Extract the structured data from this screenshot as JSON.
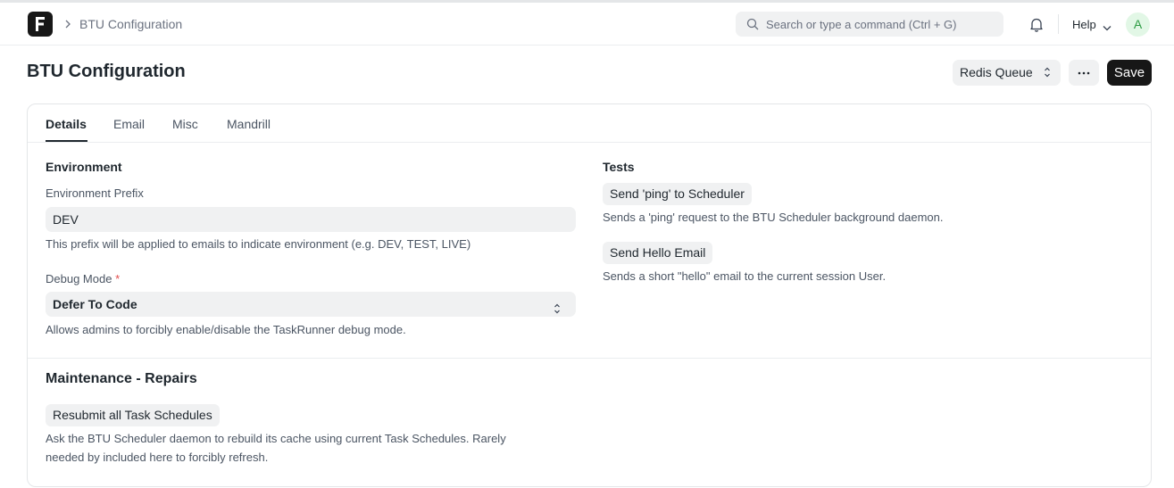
{
  "navbar": {
    "breadcrumb": "BTU Configuration",
    "search_placeholder": "Search or type a command (Ctrl + G)",
    "help_label": "Help",
    "avatar_initial": "A"
  },
  "header": {
    "title": "BTU Configuration",
    "queue_label": "Redis Queue",
    "save_label": "Save"
  },
  "tabs": [
    {
      "label": "Details",
      "active": true
    },
    {
      "label": "Email",
      "active": false
    },
    {
      "label": "Misc",
      "active": false
    },
    {
      "label": "Mandrill",
      "active": false
    }
  ],
  "environment": {
    "heading": "Environment",
    "prefix_label": "Environment Prefix",
    "prefix_value": "DEV",
    "prefix_desc": "This prefix will be applied to emails to indicate environment (e.g. DEV, TEST, LIVE)",
    "debug_label": "Debug Mode",
    "debug_required": "*",
    "debug_value": "Defer To Code",
    "debug_desc": "Allows admins to forcibly enable/disable the TaskRunner debug mode."
  },
  "tests": {
    "heading": "Tests",
    "ping_label": "Send 'ping' to Scheduler",
    "ping_desc": "Sends a 'ping' request to the BTU Scheduler background daemon.",
    "hello_label": "Send Hello Email",
    "hello_desc": "Sends a short \"hello\" email to the current session User."
  },
  "maintenance": {
    "heading": "Maintenance - Repairs",
    "resubmit_label": "Resubmit all Task Schedules",
    "resubmit_desc_line1": "Ask the BTU Scheduler daemon to rebuild its cache using current Task Schedules. Rarely",
    "resubmit_desc_line2": "needed by included here to forcibly refresh."
  },
  "colors": {
    "primary_button": "#171717",
    "control_bg": "#f0f1f2",
    "required": "#e24c4c",
    "avatar_bg": "#e2f7e6",
    "avatar_fg": "#2e9c44"
  },
  "icons": {
    "logo": "frappe-logo-icon",
    "breadcrumb_separator": "chevron-right-icon",
    "search": "search-icon",
    "notifications": "bell-icon",
    "help_dropdown": "chevron-down-icon",
    "queue_sort": "sort-icon",
    "more": "more-horizontal-icon",
    "select_caret": "select-caret-icon"
  }
}
